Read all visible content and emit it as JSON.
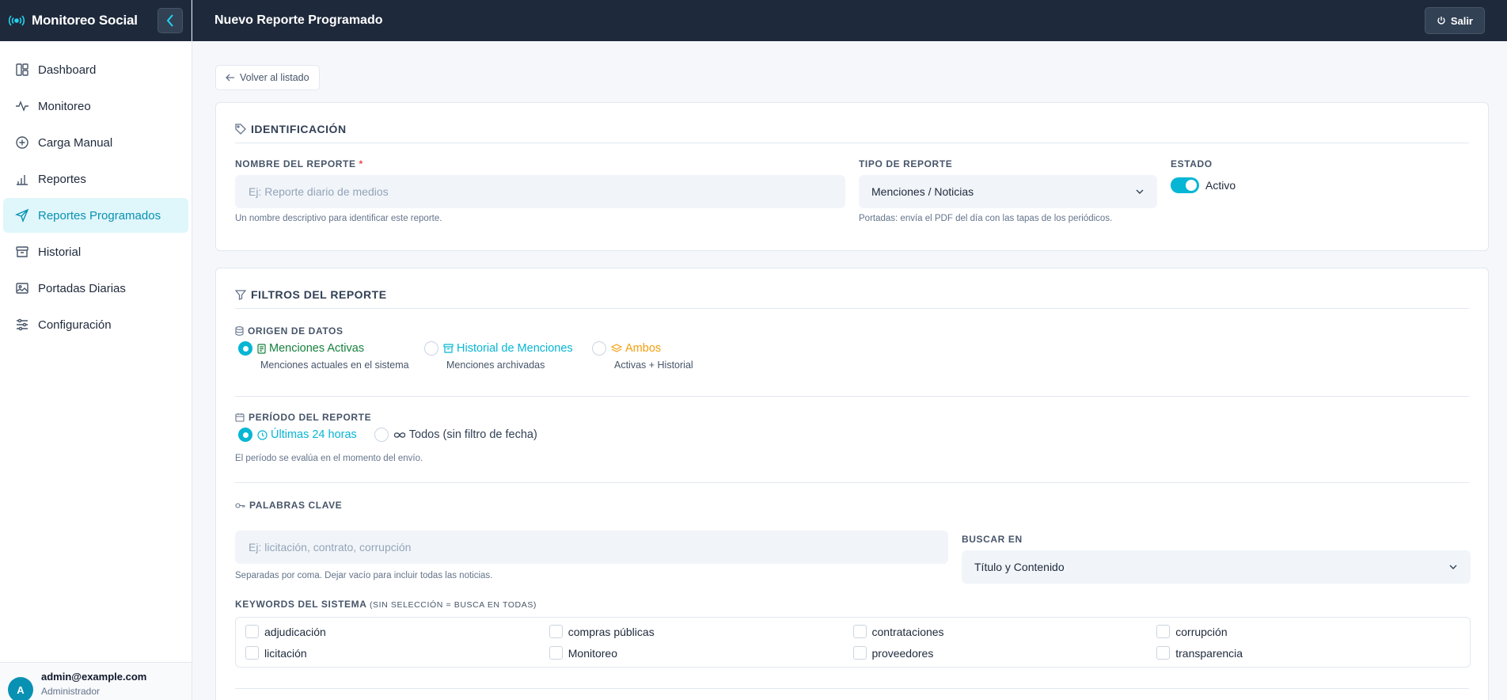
{
  "sidebar": {
    "brand": "Monitoreo Social",
    "items": [
      {
        "label": "Dashboard"
      },
      {
        "label": "Monitoreo"
      },
      {
        "label": "Carga Manual"
      },
      {
        "label": "Reportes"
      },
      {
        "label": "Reportes Programados"
      },
      {
        "label": "Historial"
      },
      {
        "label": "Portadas Diarias"
      },
      {
        "label": "Configuración"
      }
    ],
    "user": {
      "initial": "A",
      "email": "admin@example.com",
      "role": "Administrador"
    }
  },
  "header": {
    "title": "Nuevo Reporte Programado",
    "logout_label": "Salir"
  },
  "back_label": "Volver al listado",
  "identification": {
    "title": "IDENTIFICACIÓN",
    "name_label": "NOMBRE DEL REPORTE",
    "name_required": "*",
    "name_placeholder": "Ej: Reporte diario de medios",
    "name_help": "Un nombre descriptivo para identificar este reporte.",
    "type_label": "TIPO DE REPORTE",
    "type_value": "Menciones / Noticias",
    "type_help": "Portadas: envía el PDF del día con las tapas de los periódicos.",
    "status_label": "ESTADO",
    "status_value": "Activo",
    "status_on": true
  },
  "filters": {
    "title": "FILTROS DEL REPORTE",
    "origin_label": "ORIGEN DE DATOS",
    "origin_options": [
      {
        "label": "Menciones Activas",
        "sub": "Menciones actuales en el sistema",
        "color": "#15803d",
        "checked": true
      },
      {
        "label": "Historial de Menciones",
        "sub": "Menciones archivadas",
        "color": "#06b6d4",
        "checked": false
      },
      {
        "label": "Ambos",
        "sub": "Activas + Historial",
        "color": "#f59e0b",
        "checked": false
      }
    ],
    "period_label": "PERÍODO DEL REPORTE",
    "period_options": [
      {
        "label": "Últimas 24 horas",
        "checked": true
      },
      {
        "label": "Todos (sin filtro de fecha)",
        "checked": false
      }
    ],
    "period_help": "El período se evalúa en el momento del envío.",
    "keywords_label": "PALABRAS CLAVE",
    "keywords_placeholder": "Ej: licitación, contrato, corrupción",
    "keywords_help": "Separadas por coma. Dejar vacío para incluir todas las noticias.",
    "search_in_label": "BUSCAR EN",
    "search_in_value": "Título y Contenido",
    "system_keywords_label": "KEYWORDS DEL SISTEMA",
    "system_keywords_note": "(SIN SELECCIÓN = BUSCA EN TODAS)",
    "system_keywords": [
      "adjudicación",
      "compras públicas",
      "contrataciones",
      "corrupción",
      "licitación",
      "Monitoreo",
      "proveedores",
      "transparencia"
    ]
  },
  "colors": {
    "accent": "#06b6d4",
    "dark": "#1e293b",
    "active_bg": "#dff6fb"
  }
}
